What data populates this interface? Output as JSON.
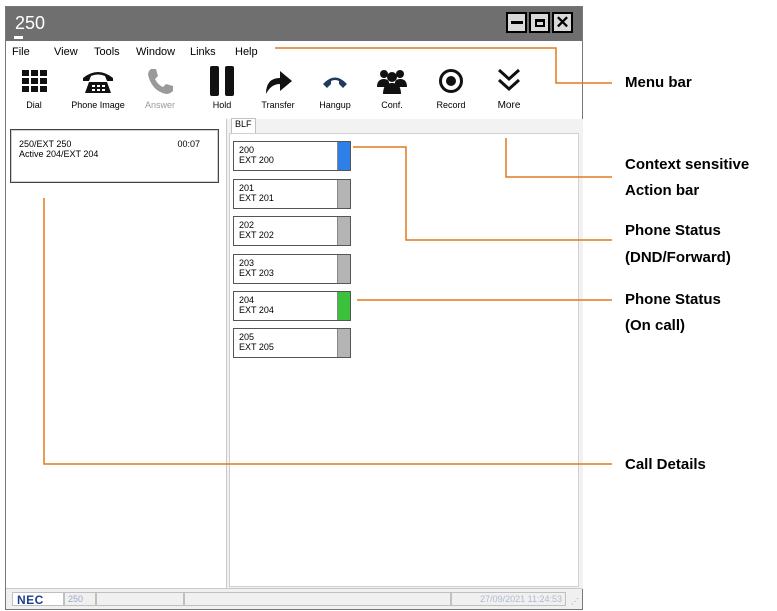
{
  "window": {
    "title": "250"
  },
  "menu": [
    "File",
    "View",
    "Tools",
    "Window",
    "Links",
    "Help"
  ],
  "toolbar": [
    {
      "label": "Dial",
      "icon": "dialpad-icon",
      "enabled": true
    },
    {
      "label": "Phone Image",
      "icon": "phone-image-icon",
      "enabled": true
    },
    {
      "label": "Answer",
      "icon": "answer-icon",
      "enabled": false
    },
    {
      "label": "Hold",
      "icon": "hold-icon",
      "enabled": true
    },
    {
      "label": "Transfer",
      "icon": "transfer-icon",
      "enabled": true
    },
    {
      "label": "Hangup",
      "icon": "hangup-icon",
      "enabled": true
    },
    {
      "label": "Conf.",
      "icon": "conference-icon",
      "enabled": true
    },
    {
      "label": "Record",
      "icon": "record-icon",
      "enabled": true
    },
    {
      "label": "More",
      "icon": "more-chevron-icon",
      "enabled": true
    }
  ],
  "call_details": {
    "line1": "250/EXT 250",
    "duration": "00:07",
    "line2": "Active 204/EXT 204"
  },
  "blf": {
    "tab_label": "BLF",
    "keys": [
      {
        "number": "200",
        "label": "EXT 200",
        "status_color": "#2f7fe8"
      },
      {
        "number": "201",
        "label": "EXT 201",
        "status_color": "#b4b4b4"
      },
      {
        "number": "202",
        "label": "EXT 202",
        "status_color": "#b4b4b4"
      },
      {
        "number": "203",
        "label": "EXT 203",
        "status_color": "#b4b4b4"
      },
      {
        "number": "204",
        "label": "EXT 204",
        "status_color": "#3cc13c"
      },
      {
        "number": "205",
        "label": "EXT 205",
        "status_color": "#b4b4b4"
      }
    ]
  },
  "statusbar": {
    "logo": "NEC",
    "extension": "250",
    "datetime": "27/09/2021 11:24:53"
  },
  "annotations": {
    "menu_bar": "Menu bar",
    "action_bar_1": "Context sensitive",
    "action_bar_2": "Action bar",
    "status_dnd_1": "Phone Status",
    "status_dnd_2": "(DND/Forward)",
    "status_call_1": "Phone Status",
    "status_call_2": "(On call)",
    "call_details": "Call Details"
  },
  "colors": {
    "annotation_line": "#e07a1f",
    "titlebar": "#6f6f6f"
  }
}
